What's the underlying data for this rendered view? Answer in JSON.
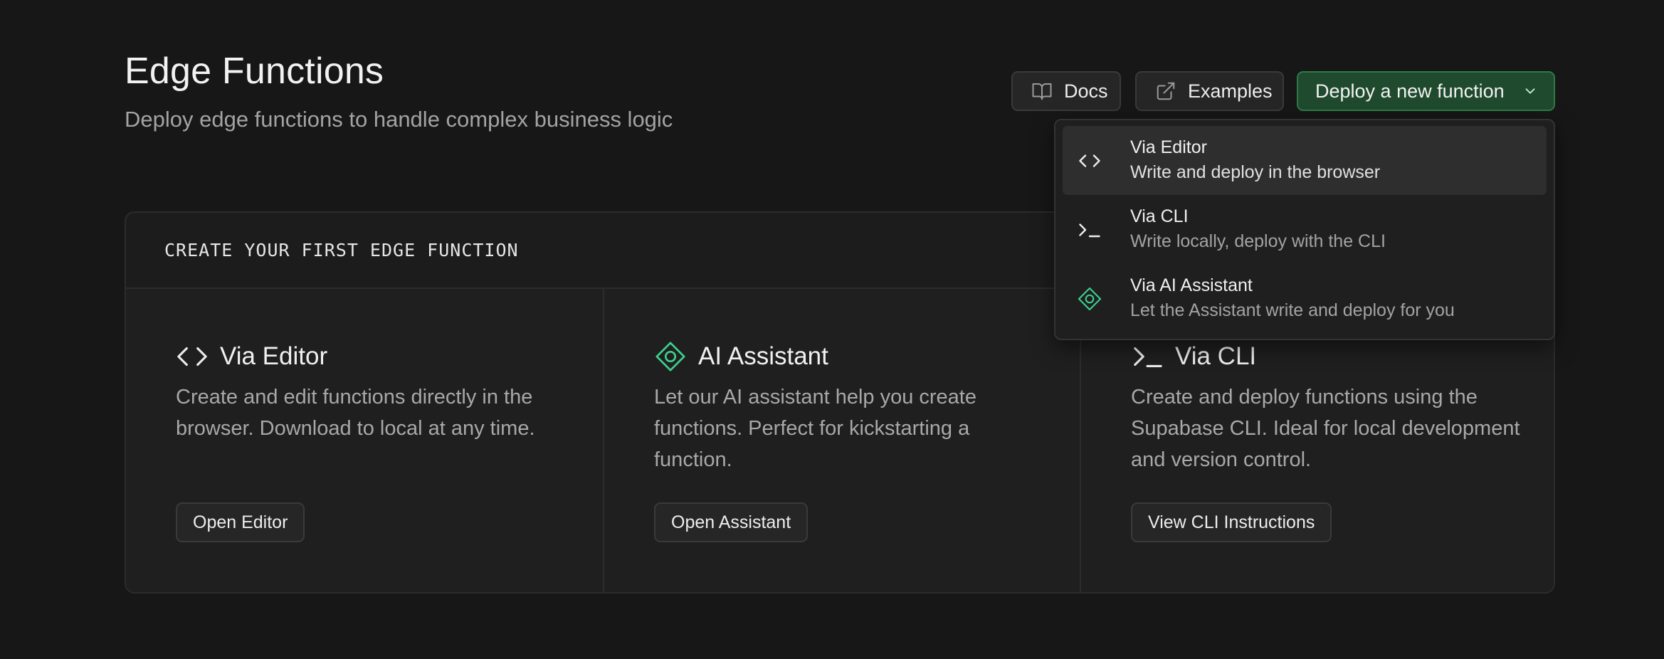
{
  "header": {
    "title": "Edge Functions",
    "subtitle": "Deploy edge functions to handle complex business logic"
  },
  "toolbar": {
    "docs_label": "Docs",
    "examples_label": "Examples",
    "deploy_label": "Deploy a new function"
  },
  "dropdown": {
    "items": [
      {
        "label": "Via Editor",
        "description": "Write and deploy in the browser",
        "icon": "code-icon"
      },
      {
        "label": "Via CLI",
        "description": "Write locally, deploy with the CLI",
        "icon": "terminal-icon"
      },
      {
        "label": "Via AI Assistant",
        "description": "Let the Assistant write and deploy for you",
        "icon": "ai-assistant-icon"
      }
    ]
  },
  "card": {
    "title": "CREATE YOUR FIRST EDGE FUNCTION",
    "columns": [
      {
        "title": "Via Editor",
        "description": "Create and edit functions directly in the browser. Download to local at any time.",
        "button": "Open Editor",
        "icon": "code-icon"
      },
      {
        "title": "AI Assistant",
        "description": "Let our AI assistant help you create functions. Perfect for kickstarting a function.",
        "button": "Open Assistant",
        "icon": "ai-assistant-icon"
      },
      {
        "title": "Via CLI",
        "description": "Create and deploy functions using the Supabase CLI. Ideal for local development and version control.",
        "button": "View CLI Instructions",
        "icon": "terminal-icon"
      }
    ]
  },
  "colors": {
    "background": "#171717",
    "accent_green": "#3ecf8e",
    "deploy_button": "#1f4a2e"
  }
}
